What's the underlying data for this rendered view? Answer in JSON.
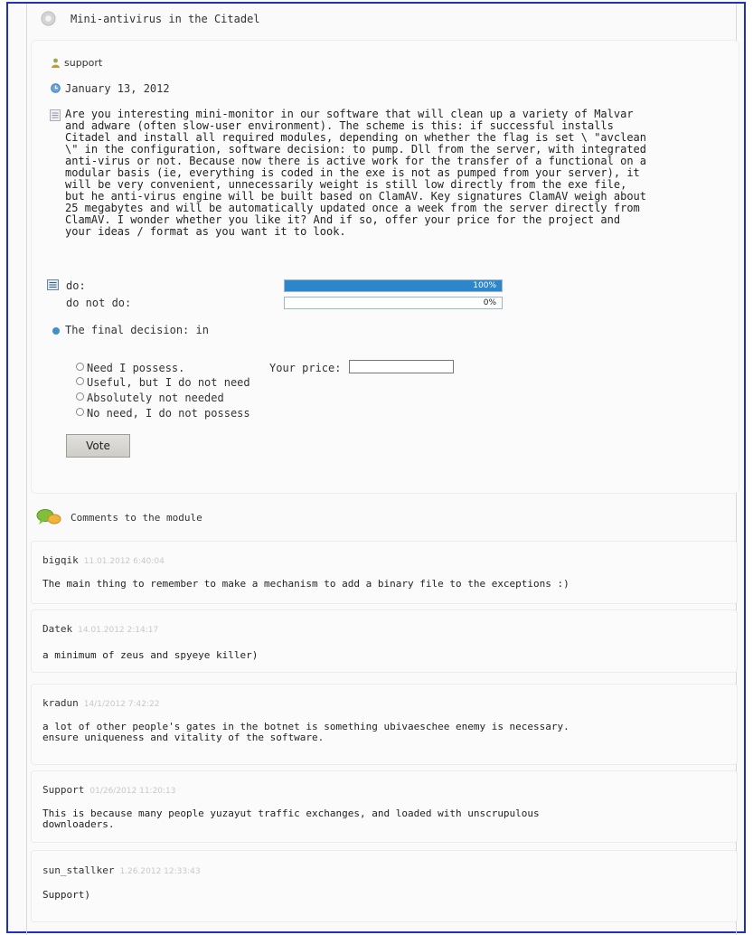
{
  "module": {
    "title": "Mini-antivirus in the Citadel",
    "author": "support",
    "date": "January 13, 2012",
    "description": "Are you interesting mini-monitor in our software that will clean up a variety of Malvar\nand adware (often slow-user environment). The scheme is this: if successful installs\nCitadel and install all required modules, depending on whether the flag is set \\ \"avclean\n\\\" in the configuration, software decision: to pump. Dll from the server, with integrated\nanti-virus or not. Because now there is active work for the transfer of a functional on a\nmodular basis (ie, everything is coded in the exe is not as pumped from your server), it\nwill be very convenient, unnecessarily weight is still low directly from the exe file,\nbut he anti-virus engine will be built based on ClamAV. Key signatures ClamAV weigh about\n25 megabytes and will be automatically updated once a week from the server directly from\nClamAV. I wonder whether you like it? And if so, offer your price for the project and\nyour ideas / format as you want it to look."
  },
  "poll": {
    "results": [
      {
        "label": "do:",
        "percent_label": "100%",
        "fraction": 1.0
      },
      {
        "label": "do not do:",
        "percent_label": "0%",
        "fraction": 0.0
      }
    ],
    "final_decision": "The final decision: in",
    "options": [
      "Need I possess.",
      "Useful, but I do not need",
      "Absolutely not needed",
      "No need, I do not possess"
    ],
    "price_label": "Your price:",
    "price_value": "",
    "vote_label": "Vote"
  },
  "comments_heading": "Comments to the module",
  "comments": [
    {
      "author": "bigqik",
      "date": "11.01.2012 6:40:04",
      "text": "The main thing to remember to make a mechanism to add a binary file to the exceptions :)"
    },
    {
      "author": "Datek",
      "date": "14.01.2012 2:14:17",
      "text": "a minimum of zeus and spyeye killer)"
    },
    {
      "author": "kradun",
      "date": "14/1/2012 7:42:22",
      "text": "a lot of other people's gates in the botnet is something ubivaeschee enemy is necessary.\nensure uniqueness and vitality of the software."
    },
    {
      "author": "Support",
      "date": "01/26/2012 11:20:13",
      "text": "This is because many people yuzayut traffic exchanges, and loaded with unscrupulous\ndownloaders."
    },
    {
      "author": "sun_stallker",
      "date": "1.26.2012 12:33:43",
      "text": "Support)"
    }
  ],
  "colors": {
    "frame_border": "#1f31b8",
    "bar_fill": "#2c86c9",
    "date_gray": "#c8c8c8"
  },
  "icons": [
    "gear-icon",
    "user-icon",
    "clock-icon",
    "document-icon",
    "list-icon",
    "bullet-icon",
    "comments-icon"
  ]
}
